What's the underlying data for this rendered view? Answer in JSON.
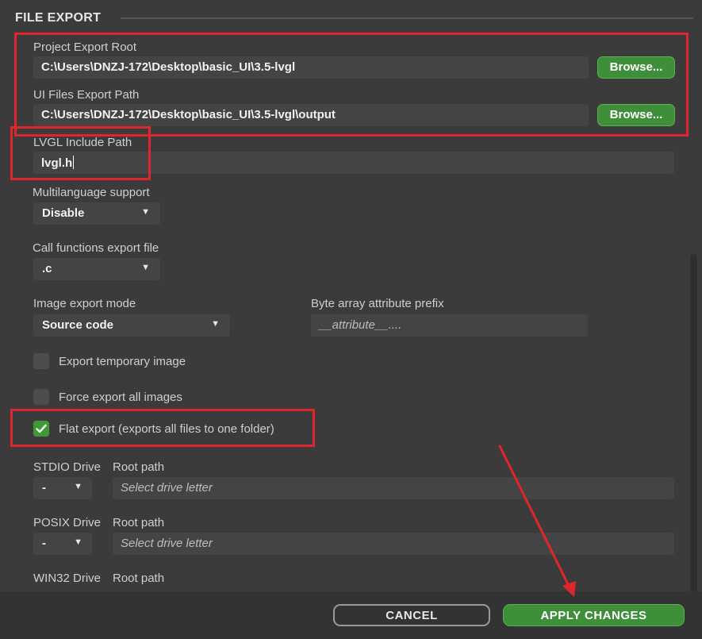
{
  "section": {
    "title": "FILE EXPORT"
  },
  "project_export_root": {
    "label": "Project Export Root",
    "value": "C:\\Users\\DNZJ-172\\Desktop\\basic_UI\\3.5-lvgl",
    "browse_label": "Browse..."
  },
  "ui_files_export_path": {
    "label": "UI Files Export Path",
    "value": "C:\\Users\\DNZJ-172\\Desktop\\basic_UI\\3.5-lvgl\\output",
    "browse_label": "Browse..."
  },
  "lvgl_include_path": {
    "label": "LVGL Include Path",
    "value": "lvgl.h"
  },
  "multilanguage": {
    "label": "Multilanguage support",
    "selected": "Disable"
  },
  "call_functions_export": {
    "label": "Call functions export file",
    "selected": ".c"
  },
  "image_export_mode": {
    "label": "Image export mode",
    "selected": "Source code"
  },
  "byte_array_prefix": {
    "label": "Byte array attribute prefix",
    "placeholder": "__attribute__...."
  },
  "checkboxes": {
    "export_temporary_image": {
      "label": "Export temporary image",
      "checked": false
    },
    "force_export_all_images": {
      "label": "Force export all images",
      "checked": false
    },
    "flat_export": {
      "label": "Flat export (exports all files to one folder)",
      "checked": true
    }
  },
  "drives": [
    {
      "label": "STDIO Drive",
      "selected": "-",
      "root_label": "Root path",
      "root_placeholder": "Select drive letter"
    },
    {
      "label": "POSIX Drive",
      "selected": "-",
      "root_label": "Root path",
      "root_placeholder": "Select drive letter"
    },
    {
      "label": "WIN32 Drive",
      "root_label": "Root path"
    }
  ],
  "footer": {
    "cancel_label": "CANCEL",
    "apply_label": "APPLY CHANGES"
  },
  "icons": {
    "dropdown": "chevron-down-icon",
    "check": "check-icon"
  },
  "colors": {
    "background": "#3b3b3b",
    "field": "#444444",
    "accent_green": "#3f8f3a",
    "annotation_red": "#e0262d"
  }
}
